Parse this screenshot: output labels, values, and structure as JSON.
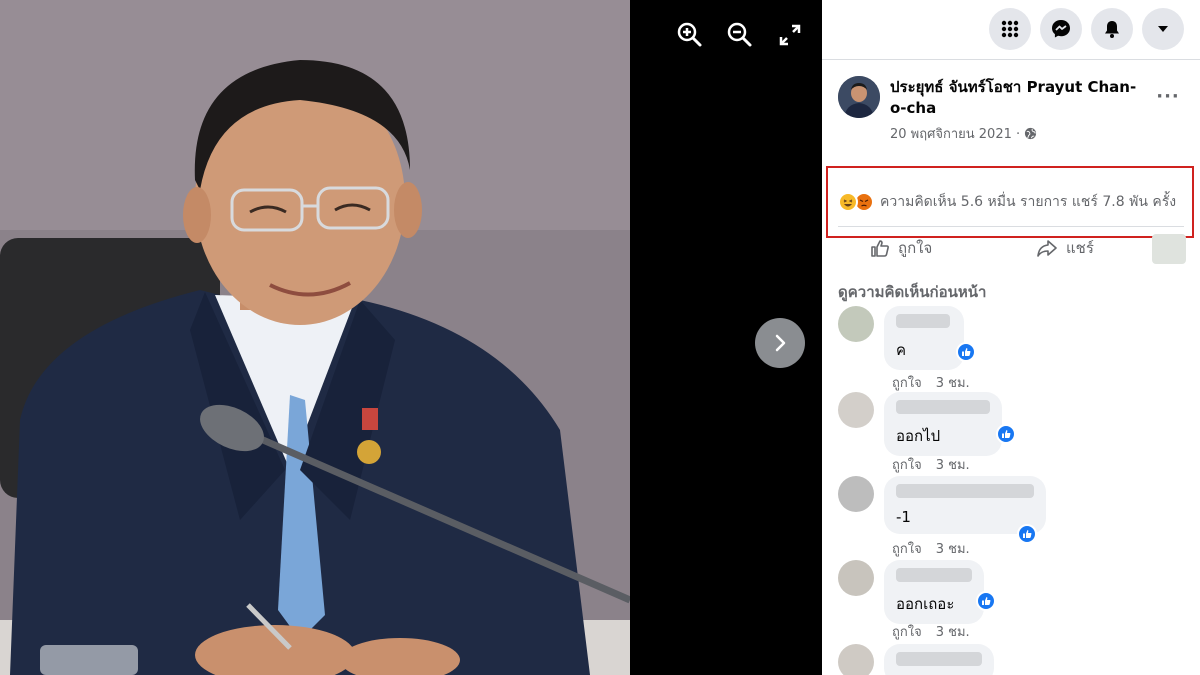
{
  "post": {
    "author": "ประยุทธ์ จันทร์โอชา Prayut Chan-o-cha",
    "date": "20 พฤศจิกายน 2021 ·",
    "stats": "ความคิดเห็น 5.6 หมื่น รายการ  แชร์ 7.8 พัน ครั้ง"
  },
  "actions": {
    "like": "ถูกใจ",
    "share": "แชร์"
  },
  "comments_section": {
    "view_previous": "ดูความคิดเห็นก่อนหน้า"
  },
  "comments": [
    {
      "text": "ค",
      "like_label": "ถูกใจ",
      "time": "3 ชม."
    },
    {
      "text": "ออกไป",
      "like_label": "ถูกใจ",
      "time": "3 ชม."
    },
    {
      "text": "-1",
      "like_label": "ถูกใจ",
      "time": "3 ชม."
    },
    {
      "text": "ออกเถอะ",
      "like_label": "ถูกใจ",
      "time": "3 ชม."
    }
  ],
  "icons": {
    "zoom_in": "zoom-in-icon",
    "zoom_out": "zoom-out-icon",
    "fullscreen": "fullscreen-icon",
    "next": "chevron-right-icon",
    "menu": "grid-menu-icon",
    "messenger": "messenger-icon",
    "notifications": "bell-icon",
    "account": "caret-down-icon",
    "privacy": "globe-icon",
    "more": "ellipsis-icon",
    "like": "thumbs-up-icon",
    "share": "share-arrow-icon",
    "reactions": [
      "haha-icon",
      "angry-icon"
    ]
  },
  "colors": {
    "highlight_box": "#d0221f",
    "facebook_blue": "#1877f2",
    "secondary_text": "#65676b"
  }
}
